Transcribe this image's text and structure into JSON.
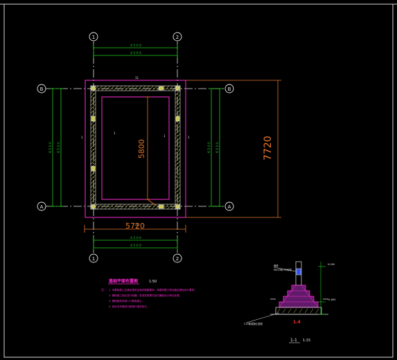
{
  "drawing": {
    "grid_axes": {
      "top": [
        "1",
        "2"
      ],
      "bottom": [
        "1",
        "2"
      ],
      "left": [
        "B",
        "A"
      ],
      "right": [
        "B",
        "A"
      ]
    },
    "dimensions": {
      "overall_width": "5720",
      "inner_height": "5800",
      "overall_height": "7720",
      "top_dim_1": "4 5 0 0",
      "top_dim_2": "4 5 0 0",
      "bottom_dim_1": "4 5 0 0",
      "bottom_dim_2": "4 5 0 0",
      "left_dim_1": "6 5 0 0",
      "left_dim_2": "6 5 0 0",
      "right_dim_1": "6 5 0 0",
      "right_dim_2": "6 5 0 0"
    },
    "plan_title": "基础平面布置图",
    "plan_scale": "1:50",
    "notes_label": "注：",
    "notes": [
      "1. 本基础施工应满足规范及相关图集要求，地基承载力特征值应满足设计要求。",
      "2. 基础施工前应进行验槽，发现异常情况及时通知设计单位处理。",
      "3. 基础垫层采用C15素混凝土。",
      "4. 其余未尽事宜均按现行规范执行。"
    ],
    "section": {
      "cut_label": "1-1",
      "scale": "1:15",
      "ratio_label": "1.4",
      "note_left": "C15素混凝土垫层",
      "note_top": "墙体",
      "note_top2": "MU10砖 M5砂浆",
      "dim_right_top": "0.000",
      "dim_right_bottom": "-0.600"
    },
    "colors": {
      "background": "#000000",
      "grid_line": "#e8e8e8",
      "dimension": "#22d022",
      "wall_outer": "#ff2bd6",
      "wall_hatch": "#c8c850",
      "annotation": "#e8762a",
      "note_text": "#ff2bd6",
      "section_fill": "#b030c0"
    }
  }
}
